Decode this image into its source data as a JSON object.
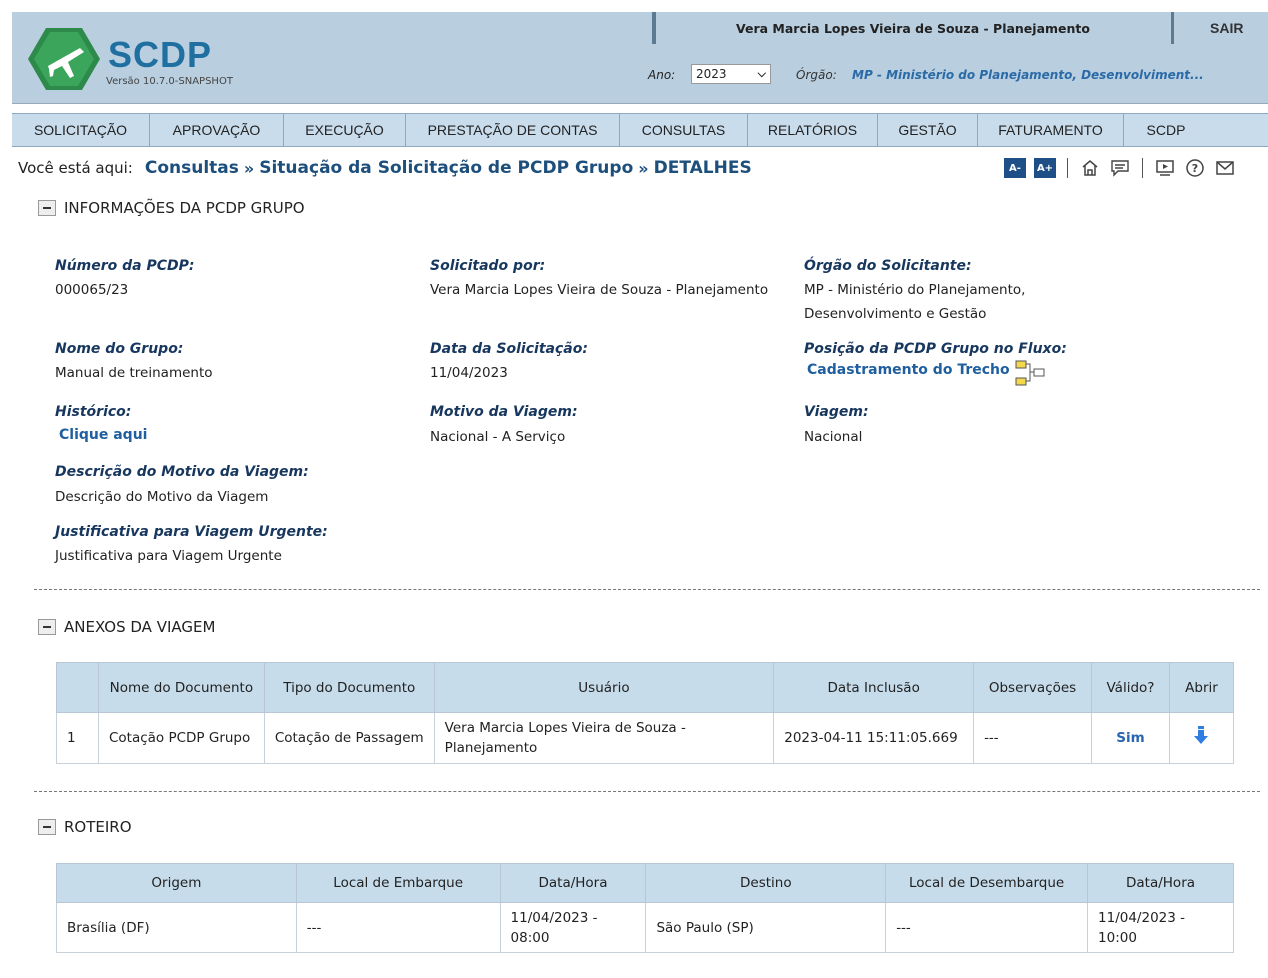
{
  "header": {
    "app_name": "SCDP",
    "version": "Versão 10.7.0-SNAPSHOT",
    "user": "Vera Marcia Lopes Vieira de Souza - Planejamento",
    "logout": "SAIR",
    "ano_label": "Ano:",
    "ano_value": "2023",
    "orgao_label": "Órgão:",
    "orgao_value": "MP - Ministério do Planejamento, Desenvolviment..."
  },
  "menu": [
    "SOLICITAÇÃO",
    "APROVAÇÃO",
    "EXECUÇÃO",
    "PRESTAÇÃO DE CONTAS",
    "CONSULTAS",
    "RELATÓRIOS",
    "GESTÃO",
    "FATURAMENTO",
    "SCDP"
  ],
  "breadcrumb": {
    "lead": "Você está aqui:",
    "items": [
      "Consultas",
      "Situação da Solicitação de PCDP Grupo",
      "DETALHES"
    ]
  },
  "toolbar": {
    "font_decrease": "A-",
    "font_increase": "A+"
  },
  "info": {
    "title": "INFORMAÇÕES DA PCDP GRUPO",
    "numero_label": "Número da PCDP:",
    "numero_value": "000065/23",
    "solicitado_label": "Solicitado por:",
    "solicitado_value": "Vera Marcia Lopes Vieira de Souza - Planejamento",
    "orgao_label": "Órgão do Solicitante:",
    "orgao_value_1": "MP - Ministério do Planejamento,",
    "orgao_value_2": "Desenvolvimento e Gestão",
    "grupo_label": "Nome do Grupo:",
    "grupo_value": "Manual de treinamento",
    "data_label": "Data da Solicitação:",
    "data_value": "11/04/2023",
    "posicao_label": "Posição da PCDP Grupo no Fluxo:",
    "posicao_value": "Cadastramento do Trecho",
    "historico_label": "Histórico:",
    "historico_value": "Clique aqui",
    "motivo_label": "Motivo da Viagem:",
    "motivo_value": "Nacional - A Serviço",
    "viagem_label": "Viagem:",
    "viagem_value": "Nacional",
    "descricao_label": "Descrição do Motivo da Viagem:",
    "descricao_value": "Descrição do Motivo da Viagem",
    "justificativa_label": "Justificativa para Viagem Urgente:",
    "justificativa_value": "Justificativa para Viagem Urgente"
  },
  "anexos": {
    "title": "ANEXOS DA VIAGEM",
    "headers": [
      "",
      "Nome do Documento",
      "Tipo do Documento",
      "Usuário",
      "Data Inclusão",
      "Observações",
      "Válido?",
      "Abrir"
    ],
    "rows": [
      {
        "n": "1",
        "nome": "Cotação PCDP Grupo",
        "tipo": "Cotação de Passagem",
        "usuario": "Vera Marcia Lopes Vieira de Souza - Planejamento",
        "data": "2023-04-11 15:11:05.669",
        "obs": "---",
        "valido": "Sim"
      }
    ]
  },
  "roteiro": {
    "title": "ROTEIRO",
    "headers": [
      "Origem",
      "Local de Embarque",
      "Data/Hora",
      "Destino",
      "Local de Desembarque",
      "Data/Hora"
    ],
    "rows": [
      {
        "origem": "Brasília (DF)",
        "embarque": "---",
        "data1": "11/04/2023 - 08:00",
        "destino": "São Paulo (SP)",
        "desembarque": "---",
        "data2": "11/04/2023 - 10:00"
      }
    ]
  }
}
